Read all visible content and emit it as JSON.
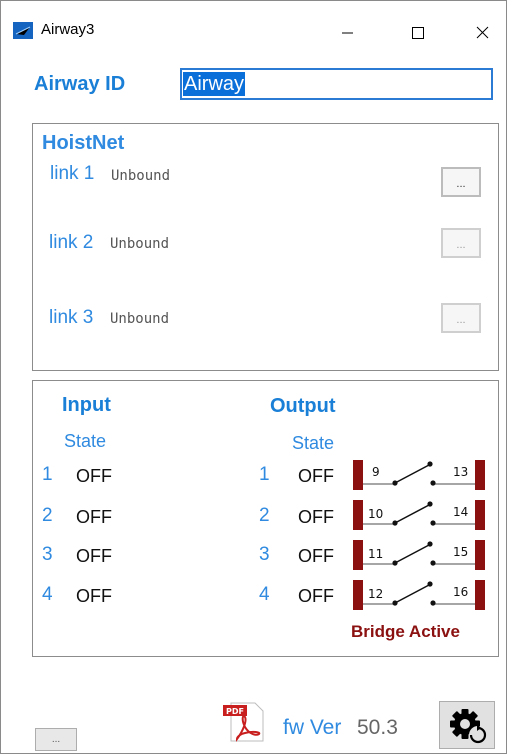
{
  "window": {
    "title": "Airway3"
  },
  "airway": {
    "label": "Airway ID",
    "value": "Airway"
  },
  "hoistnet": {
    "title": "HoistNet",
    "links": [
      {
        "name": "link 1",
        "status": "Unbound",
        "button": "..."
      },
      {
        "name": "link 2",
        "status": "Unbound",
        "button": "..."
      },
      {
        "name": "link 3",
        "status": "Unbound",
        "button": "..."
      }
    ]
  },
  "input": {
    "title": "Input",
    "state_label": "State",
    "rows": [
      {
        "num": "1",
        "state": "OFF"
      },
      {
        "num": "2",
        "state": "OFF"
      },
      {
        "num": "3",
        "state": "OFF"
      },
      {
        "num": "4",
        "state": "OFF"
      }
    ]
  },
  "output": {
    "title": "Output",
    "state_label": "State",
    "rows": [
      {
        "num": "1",
        "state": "OFF",
        "left_pin": "9",
        "right_pin": "13"
      },
      {
        "num": "2",
        "state": "OFF",
        "left_pin": "10",
        "right_pin": "14"
      },
      {
        "num": "3",
        "state": "OFF",
        "left_pin": "11",
        "right_pin": "15"
      },
      {
        "num": "4",
        "state": "OFF",
        "left_pin": "12",
        "right_pin": "16"
      }
    ]
  },
  "bridge_status": "Bridge Active",
  "footer": {
    "fw_label": "fw Ver",
    "fw_version": "50.3",
    "pdf_badge": "PDF",
    "small_button": "..."
  },
  "colors": {
    "accent": "#1a7fd6",
    "relay": "#8b1010"
  }
}
